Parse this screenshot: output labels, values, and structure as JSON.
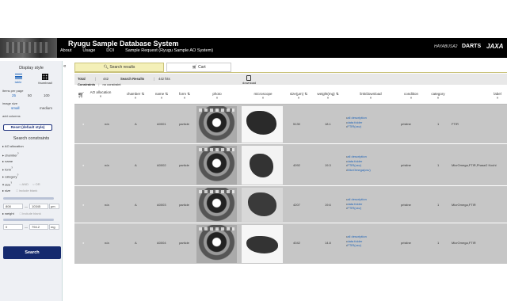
{
  "header": {
    "title": "Ryugu Sample Database System",
    "nav": [
      "About",
      "Usage",
      "DOI",
      "Sample Request (Ryugu Sample AO System)"
    ],
    "brands": [
      "HAYABUSA2",
      "DARTS",
      "JAXA"
    ]
  },
  "sidebar": {
    "display_style_heading": "Display style",
    "table_label": "table",
    "thumbnail_label": "thumbnail",
    "items_per_page_label": "items per page",
    "items_per_page_options": [
      "25",
      "50",
      "100"
    ],
    "image_size_label": "image size",
    "image_size_options": [
      "small",
      "medium"
    ],
    "add_columns_label": "add columns",
    "reset_button": "Reset (default style)",
    "constraints_heading": "Search constraints",
    "constraints": [
      "AO allocation",
      "chamber",
      "name",
      "form",
      "category",
      "size",
      "size"
    ],
    "toggle_labels": [
      "AND",
      "OR"
    ],
    "include_blank": "include blank",
    "size_min": "808",
    "size_max": "10345",
    "size_unit": "μm",
    "weight_label": "weight",
    "weight_min": "0",
    "weight_max": "794.2",
    "weight_unit": "mg",
    "search_button": "Search"
  },
  "tabs": {
    "search_results": "Search results",
    "cart": "Cart"
  },
  "info": {
    "total_label": "Total",
    "total_value": "442",
    "results_label": "Search Results",
    "results_value": "442 hits",
    "constraints_label": "Constraints",
    "constraints_value": "no constraint",
    "download_label": "download"
  },
  "columns": [
    "AO allocation",
    "chamber",
    "name",
    "form",
    "photo",
    "microscope",
    "size(μm)",
    "weight(mg)",
    "link/download",
    "condition",
    "category",
    "label"
  ],
  "rows": [
    {
      "ao": "n/a",
      "chamber": "A",
      "name": "A0001",
      "form": "particle",
      "size": "5130",
      "weight": "18.1",
      "links": [
        "all description",
        "data folder",
        "FTIR(csv)"
      ],
      "condition": "pristine",
      "category": "1",
      "label": "FTIR"
    },
    {
      "ao": "n/a",
      "chamber": "A",
      "name": "A0002",
      "form": "particle",
      "size": "4092",
      "weight": "19.3",
      "links": [
        "all description",
        "data folder",
        "FTIR(csv)",
        "MicrOmega(csv)"
      ],
      "condition": "pristine",
      "category": "1",
      "label": "MicrOmega,FTIR,Phase2 Kochi"
    },
    {
      "ao": "n/a",
      "chamber": "A",
      "name": "A0003",
      "form": "particle",
      "size": "4207",
      "weight": "19.6",
      "links": [
        "all description",
        "data folder",
        "FTIR(csv)"
      ],
      "condition": "pristine",
      "category": "1",
      "label": "MicrOmega,FTIR"
    },
    {
      "ao": "n/a",
      "chamber": "A",
      "name": "A0004",
      "form": "particle",
      "size": "4042",
      "weight": "14.8",
      "links": [
        "all description",
        "data folder",
        "FTIR(csv)"
      ],
      "condition": "pristine",
      "category": "1",
      "label": "MicrOmega,FTIR"
    }
  ],
  "colors": {
    "header_bg": "#000000",
    "search_button": "#152a6e",
    "active_tab": "#f4f0b8",
    "row_bg": "#c6c6c6",
    "link": "#1b62b8"
  }
}
